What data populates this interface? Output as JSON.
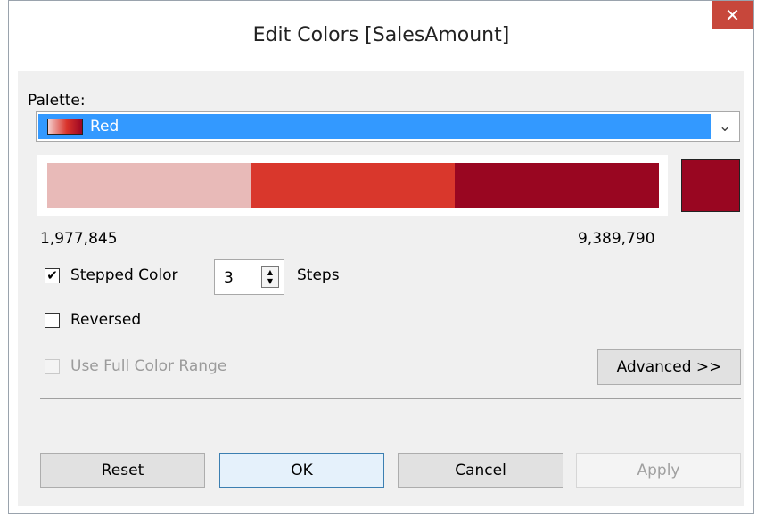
{
  "dialog": {
    "title": "Edit Colors [SalesAmount]",
    "close_glyph": "✕"
  },
  "palette": {
    "label": "Palette:",
    "selected": "Red",
    "dropdown_glyph": "⌄"
  },
  "ramp": {
    "step_colors": [
      "#e8bab8",
      "#d9372c",
      "#990621"
    ],
    "sample_color": "#990621",
    "min_value": "1,977,845",
    "max_value": "9,389,790"
  },
  "stepped_color": {
    "checked": true,
    "check_glyph": "✔",
    "label": "Stepped Color",
    "steps_value": "3",
    "steps_label": "Steps"
  },
  "reversed": {
    "checked": false,
    "label": "Reversed"
  },
  "full_range": {
    "checked": false,
    "enabled": false,
    "label": "Use Full Color Range"
  },
  "advanced_label": "Advanced >>",
  "buttons": {
    "reset": "Reset",
    "ok": "OK",
    "cancel": "Cancel",
    "apply": "Apply"
  }
}
